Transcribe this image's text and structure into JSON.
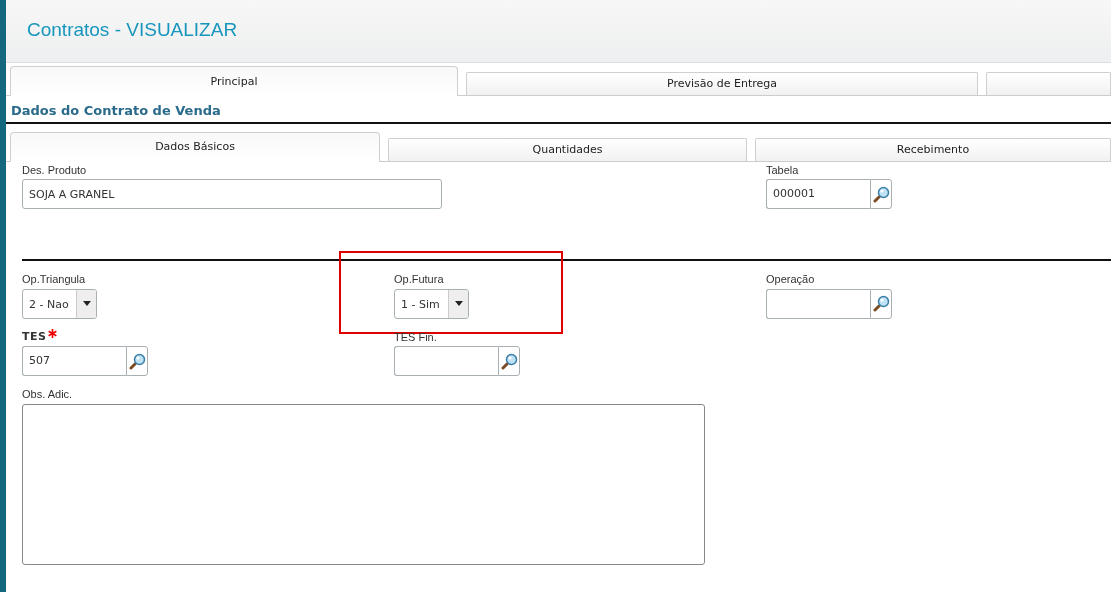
{
  "title": "Contratos - VISUALIZAR",
  "tabs": [
    {
      "label": "Principal",
      "selected": true
    },
    {
      "label": "Previsão de Entrega",
      "selected": false
    },
    {
      "selected": false
    }
  ],
  "section_title": "Dados do Contrato de Venda",
  "subtabs": [
    {
      "label": "Dados Básicos",
      "selected": true
    },
    {
      "label": "Quantidades",
      "selected": false
    },
    {
      "label": "Recebimento",
      "selected": false
    }
  ],
  "rows": [
    [
      {
        "kind": "text",
        "label": "Des. Produto",
        "value": "SOJA A GRANEL"
      },
      {
        "kind": "lookup",
        "label": "Tabela",
        "value": "000001"
      }
    ],
    [
      {
        "kind": "select",
        "label": "Op.Triangula",
        "value": "2 - Nao"
      },
      {
        "kind": "select",
        "label": "Op.Futura",
        "value": "1 - Sim",
        "highlighted": true
      },
      {
        "kind": "lookup",
        "label": "Operação"
      }
    ],
    [
      {
        "kind": "lookup",
        "label": "TES",
        "value": "507",
        "required": true
      },
      {
        "kind": "lookup",
        "label": "TES Fin."
      }
    ],
    [
      {
        "kind": "textarea",
        "label": "Obs. Adic."
      }
    ]
  ]
}
